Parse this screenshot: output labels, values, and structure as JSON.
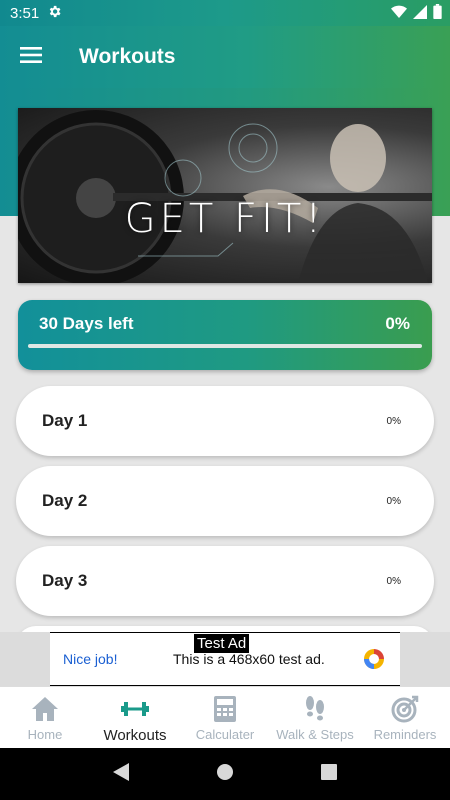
{
  "status": {
    "time": "3:51"
  },
  "app_bar": {
    "title": "Workouts"
  },
  "banner": {
    "text": "GET FIT!"
  },
  "progress": {
    "days_left": "30 Days left",
    "percent_label": "0%",
    "fraction": 0.0
  },
  "days": [
    {
      "label": "Day 1",
      "percent": "0%"
    },
    {
      "label": "Day 2",
      "percent": "0%"
    },
    {
      "label": "Day 3",
      "percent": "0%"
    }
  ],
  "ad": {
    "tag": "Test Ad",
    "left_text": "Nice job!",
    "main_text": "This is a 468x60 test ad."
  },
  "bottom_nav": {
    "items": [
      {
        "label": "Home",
        "icon": "home-icon",
        "active": false
      },
      {
        "label": "Workouts",
        "icon": "dumbbell-icon",
        "active": true
      },
      {
        "label": "Calculater",
        "icon": "calculator-icon",
        "active": false
      },
      {
        "label": "Walk & Steps",
        "icon": "footsteps-icon",
        "active": false
      },
      {
        "label": "Reminders",
        "icon": "target-icon",
        "active": false
      }
    ]
  },
  "colors": {
    "gradient_start": "#12909a",
    "gradient_end": "#3a9d4f",
    "nav_inactive": "#a8b3bd",
    "nav_active_icon": "#1a9a8a"
  }
}
